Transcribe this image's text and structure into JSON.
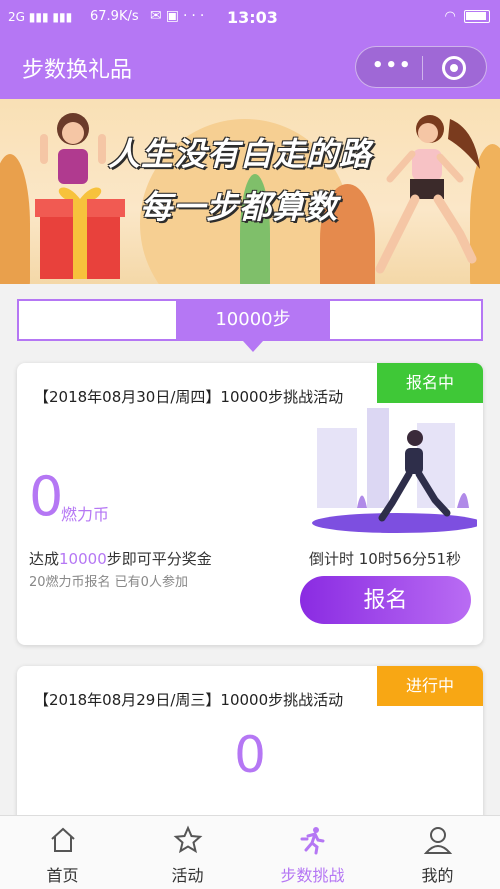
{
  "status_bar": {
    "network": "2G",
    "speed": "67.9K/s",
    "more": "···",
    "time": "13:03"
  },
  "header": {
    "title": "步数换礼品",
    "menu_dots": "•••"
  },
  "banner": {
    "line1": "人生没有白走的路",
    "line2": "每一步都算数"
  },
  "step_tabs": {
    "active_label": "10000步"
  },
  "cards": [
    {
      "title": "【2018年08月30日/周四】10000步挑战活动",
      "badge": "报名中",
      "coins": "0",
      "coin_unit": "燃力币",
      "desc_prefix": "达成",
      "desc_highlight": "10000",
      "desc_suffix": "步即可平分奖金",
      "sub": "20燃力币报名 已有0人参加",
      "countdown": "倒计时 10时56分51秒",
      "button": "报名"
    },
    {
      "title": "【2018年08月29日/周三】10000步挑战活动",
      "badge": "进行中",
      "coins": "0"
    }
  ],
  "tabbar": {
    "items": [
      {
        "label": "首页",
        "icon": "home-icon"
      },
      {
        "label": "活动",
        "icon": "star-icon"
      },
      {
        "label": "步数挑战",
        "icon": "runner-icon"
      },
      {
        "label": "我的",
        "icon": "user-icon"
      }
    ],
    "active_index": 2
  },
  "colors": {
    "brand": "#b577f4",
    "badge_signup": "#3fc837",
    "badge_ongoing": "#f8a714"
  }
}
